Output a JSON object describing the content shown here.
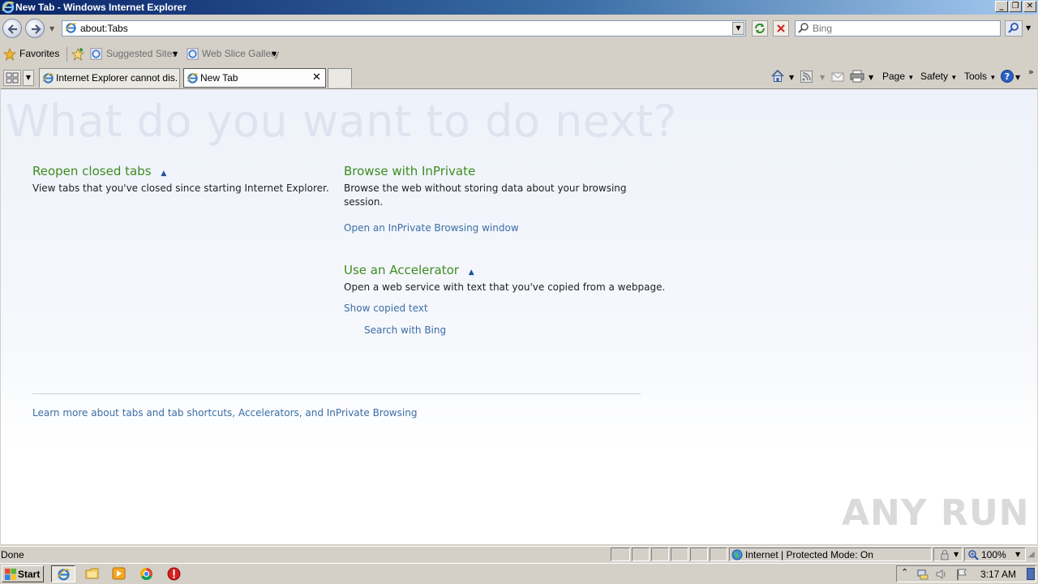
{
  "window": {
    "title": "New Tab - Windows Internet Explorer",
    "controls": {
      "minimize": "_",
      "restore": "❐",
      "close": "✕"
    }
  },
  "nav": {
    "address": "about:Tabs",
    "search_placeholder": "Bing"
  },
  "favorites_bar": {
    "favorites_label": "Favorites",
    "suggested_sites": "Suggested Sites",
    "web_slice_gallery": "Web Slice Gallery"
  },
  "tabs": [
    {
      "label": "Internet Explorer cannot dis...",
      "active": false
    },
    {
      "label": "New Tab",
      "active": true
    }
  ],
  "command_bar": {
    "page": "Page",
    "safety": "Safety",
    "tools": "Tools"
  },
  "content": {
    "headline": "What do you want to do next?",
    "reopen": {
      "title": "Reopen closed tabs",
      "text": "View tabs that you've closed since starting Internet Explorer."
    },
    "inprivate": {
      "title": "Browse with InPrivate",
      "text": "Browse the web without storing data about your browsing session.",
      "link": "Open an InPrivate Browsing window"
    },
    "accelerator": {
      "title": "Use an Accelerator",
      "text": "Open a web service with text that you've copied from a webpage.",
      "link": "Show copied text",
      "sublink": "Search with Bing"
    },
    "learn_more": "Learn more about tabs and tab shortcuts, Accelerators, and InPrivate Browsing"
  },
  "status": {
    "left": "Done",
    "zone": "Internet | Protected Mode: On",
    "zoom": "100%"
  },
  "taskbar": {
    "start": "Start",
    "clock": "3:17 AM"
  },
  "watermark": "ANY RUN"
}
